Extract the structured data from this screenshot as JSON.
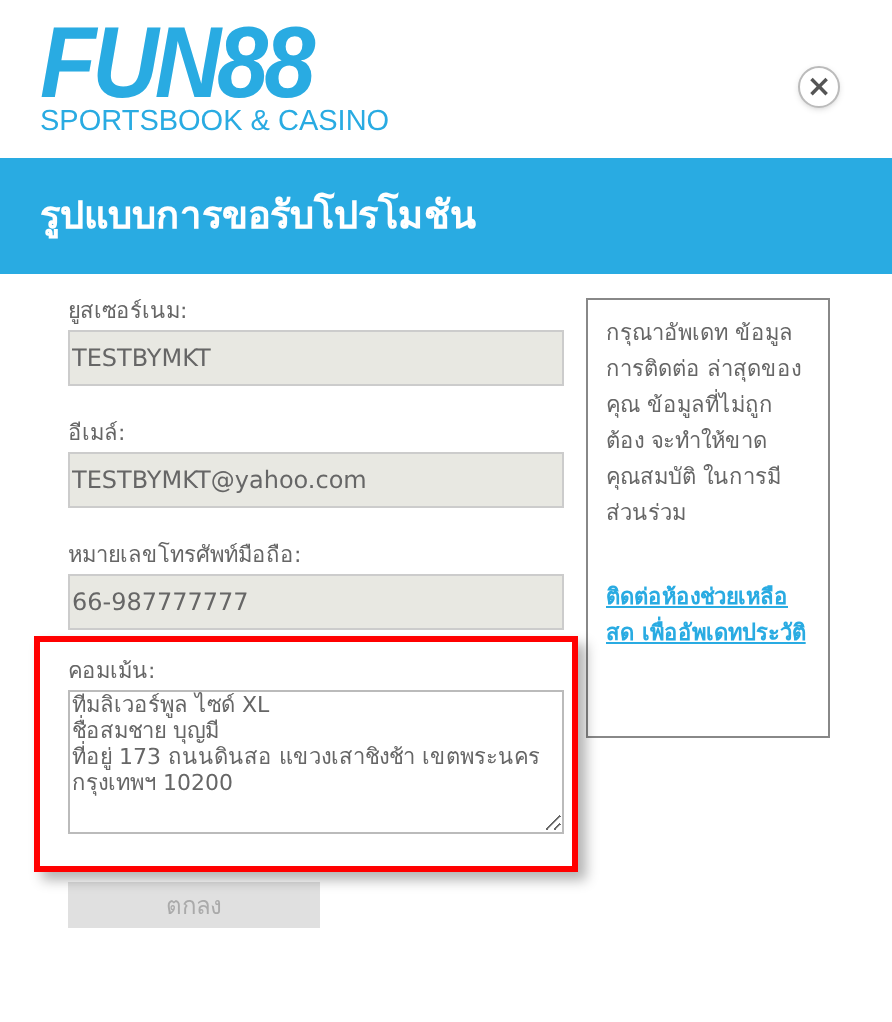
{
  "logo": {
    "name": "FUN88",
    "tagline": "SPORTSBOOK & CASINO"
  },
  "close_button": {
    "label": "×"
  },
  "header": {
    "title": "รูปแบบการขอรับโปรโมชัน"
  },
  "fields": [
    {
      "label": "ยูสเซอร์เนม:",
      "value": "TESTBYMKT",
      "kind": "text",
      "disabled": true
    },
    {
      "label": "อีเมล์:",
      "value": "TESTBYMKT@yahoo.com",
      "kind": "text",
      "disabled": true
    },
    {
      "label": "หมายเลขโทรศัพท์มือถือ:",
      "value": "66-987777777",
      "kind": "text",
      "disabled": true
    },
    {
      "label": "คอมเม้น:",
      "value": "ทีมลิเวอร์พูล ไซด์ XL\nชื่อสมชาย บุญมี\nที่อยู่ 173 ถนนดินสอ แขวงเสาชิงช้า เขตพระนคร\nกรุงเทพฯ 10200",
      "kind": "textarea",
      "disabled": false,
      "highlighted": true
    }
  ],
  "submit_button": {
    "label": "ตกลง",
    "disabled": true
  },
  "notice": {
    "text": "กรุณาอัพเดท ข้อมูลการติดต่อ ล่าสุดของคุณ ข้อมูลที่ไม่ถูกต้อง จะทำให้ขาดคุณสมบัติ ในการมีส่วนร่วม",
    "link": "ติดต่อห้องช่วยเหลือสด เพื่ออัพเดทประวัติ"
  }
}
